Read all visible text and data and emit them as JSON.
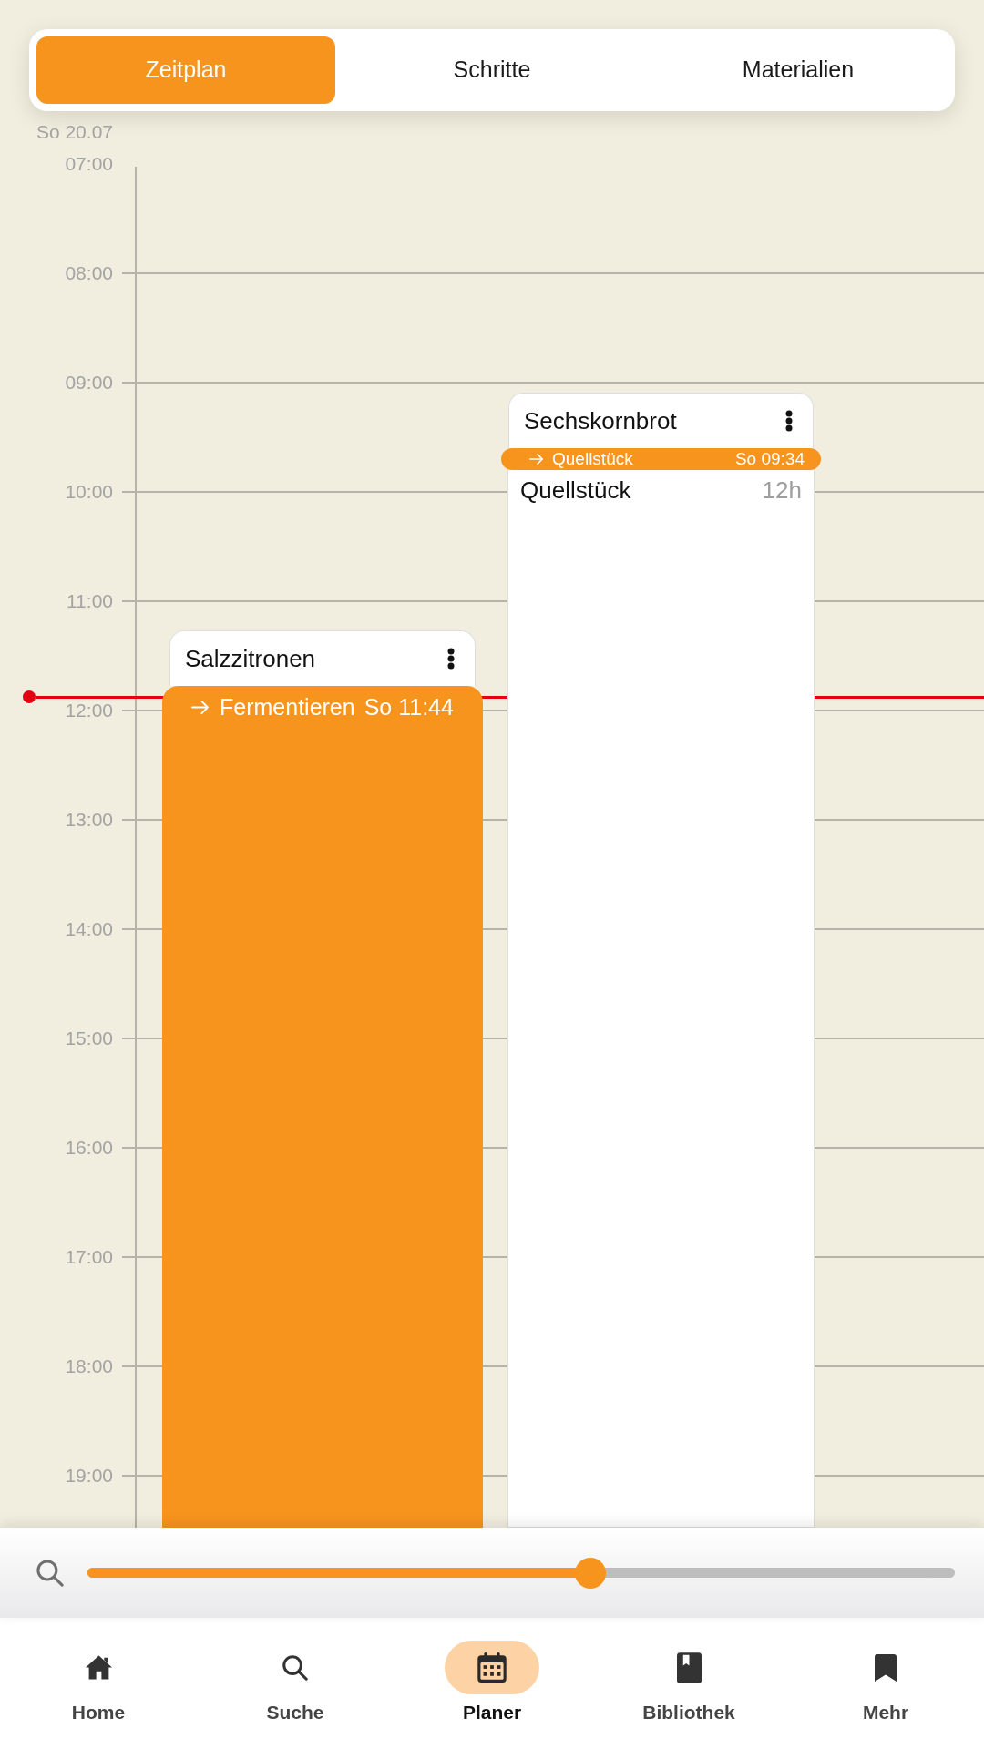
{
  "tabs": [
    {
      "label": "Zeitplan",
      "selected": true
    },
    {
      "label": "Schritte",
      "selected": false
    },
    {
      "label": "Materialien",
      "selected": false
    }
  ],
  "timeline": {
    "date": "So 20.07",
    "hours": [
      "07:00",
      "08:00",
      "09:00",
      "10:00",
      "11:00",
      "12:00",
      "13:00",
      "14:00",
      "15:00",
      "16:00",
      "17:00",
      "18:00",
      "19:00"
    ],
    "events": [
      {
        "title": "Sechskornbrot",
        "highlighted": false,
        "step": {
          "name": "Quellstück",
          "time": "So 09:34"
        },
        "rows": [
          {
            "name": "Quellstück",
            "duration": "12h"
          }
        ]
      },
      {
        "title": "Salzzitronen",
        "highlighted": true,
        "step": {
          "name": "Fermentieren",
          "time": "So 11:44"
        }
      }
    ]
  },
  "zoom_slider": {
    "level": 0.58
  },
  "nav": [
    {
      "label": "Home",
      "selected": false
    },
    {
      "label": "Suche",
      "selected": false
    },
    {
      "label": "Planer",
      "selected": true
    },
    {
      "label": "Bibliothek",
      "selected": false
    },
    {
      "label": "Mehr",
      "selected": false
    }
  ]
}
